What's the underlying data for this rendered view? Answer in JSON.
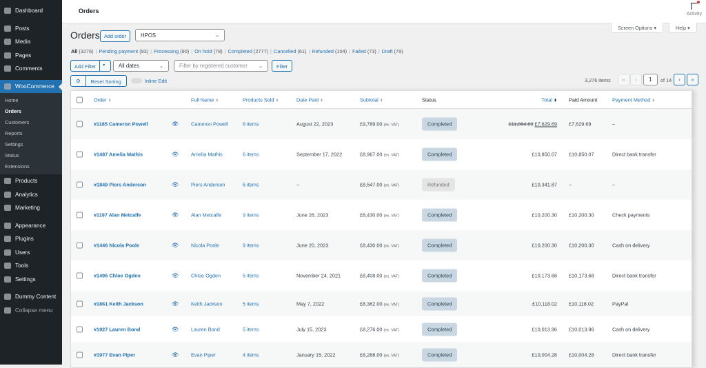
{
  "sidebar": {
    "items_top": [
      {
        "label": "Dashboard",
        "icon": "dashboard-icon"
      }
    ],
    "group1": [
      {
        "label": "Posts",
        "icon": "pin-icon"
      },
      {
        "label": "Media",
        "icon": "media-icon"
      },
      {
        "label": "Pages",
        "icon": "pages-icon"
      },
      {
        "label": "Comments",
        "icon": "comment-icon"
      }
    ],
    "woo": {
      "label": "WooCommerce",
      "icon": "woo-icon",
      "sub": [
        "Home",
        "Orders",
        "Customers",
        "Reports",
        "Settings",
        "Status",
        "Extensions"
      ]
    },
    "group2": [
      {
        "label": "Products",
        "icon": "archive-icon"
      },
      {
        "label": "Analytics",
        "icon": "bar-chart-icon"
      },
      {
        "label": "Marketing",
        "icon": "megaphone-icon"
      }
    ],
    "group3": [
      {
        "label": "Appearance",
        "icon": "brush-icon"
      },
      {
        "label": "Plugins",
        "icon": "plug-icon"
      },
      {
        "label": "Users",
        "icon": "user-icon"
      },
      {
        "label": "Tools",
        "icon": "wrench-icon"
      },
      {
        "label": "Settings",
        "icon": "settings-icon"
      }
    ],
    "group4": [
      {
        "label": "Dummy Content",
        "icon": "database-icon"
      },
      {
        "label": "Collapse menu",
        "icon": "collapse-icon"
      }
    ]
  },
  "header": {
    "title": "Orders",
    "activity": "Activity"
  },
  "screen_options": "Screen Options ▾",
  "help": "Help ▾",
  "page": {
    "title": "Orders",
    "add_order": "Add order",
    "view_select": "HPOS"
  },
  "views": [
    {
      "label": "All",
      "count": "(3276)"
    },
    {
      "label": "Pending payment",
      "count": "(93)"
    },
    {
      "label": "Processing",
      "count": "(90)"
    },
    {
      "label": "On hold",
      "count": "(78)"
    },
    {
      "label": "Completed",
      "count": "(2777)"
    },
    {
      "label": "Cancelled",
      "count": "(61)"
    },
    {
      "label": "Refunded",
      "count": "(104)"
    },
    {
      "label": "Failed",
      "count": "(73)"
    },
    {
      "label": "Draft",
      "count": "(79)"
    }
  ],
  "filters": {
    "add_filter": "Add Filter",
    "dates": "All dates",
    "customer_placeholder": "Filter by registered customer",
    "filter": "Filter",
    "reset_sorting": "Reset Sorting",
    "inline_edit": "Inline Edit"
  },
  "pagination": {
    "items": "3,276 items",
    "first": "«",
    "prev": "‹",
    "current": "1",
    "of": "of 14",
    "next": "›",
    "last": "»"
  },
  "columns": {
    "order": "Order",
    "full_name": "Full Name",
    "products": "Products Sold",
    "date": "Date Paid",
    "subtotal": "Subtotal",
    "status": "Status",
    "total": "Total",
    "paid": "Paid Amount",
    "payment": "Payment Method"
  },
  "vat": "(ex. VAT)",
  "orders": [
    {
      "order": "#1185 Cameron Powell",
      "name": "Cameron Powell",
      "items": "6 items",
      "date": "August 22, 2023",
      "subtotal": "£9,789.00",
      "status": "Completed",
      "total_old": "£11,864.69",
      "total": "£7,629.69",
      "paid": "£7,629.69",
      "method": "–"
    },
    {
      "order": "#1487 Amelia Mathis",
      "name": "Amelia Mathis",
      "items": "6 items",
      "date": "September 17, 2022",
      "subtotal": "£8,967.00",
      "status": "Completed",
      "total": "£10,850.07",
      "paid": "£10,850.07",
      "method": "Direct bank transfer"
    },
    {
      "order": "#1849 Piers Anderson",
      "name": "Piers Anderson",
      "items": "6 items",
      "date": "–",
      "subtotal": "£8,547.00",
      "status": "Refunded",
      "total": "£10,341.87",
      "paid": "–",
      "method": "–"
    },
    {
      "order": "#1197 Alan Metcalfe",
      "name": "Alan Metcalfe",
      "items": "9 items",
      "date": "June 26, 2023",
      "subtotal": "£8,430.00",
      "status": "Completed",
      "total": "£10,200.30",
      "paid": "£10,200.30",
      "method": "Check payments"
    },
    {
      "order": "#1446 Nicola Poole",
      "name": "Nicola Poole",
      "items": "9 items",
      "date": "June 20, 2023",
      "subtotal": "£8,430.00",
      "status": "Completed",
      "total": "£10,200.30",
      "paid": "£10,200.30",
      "method": "Cash on delivery"
    },
    {
      "order": "#1495 Chloe Ogden",
      "name": "Chloe Ogden",
      "items": "5 items",
      "date": "November 24, 2021",
      "subtotal": "£8,408.00",
      "status": "Completed",
      "total": "£10,173.68",
      "paid": "£10,173.68",
      "method": "Direct bank transfer"
    },
    {
      "order": "#1861 Keith Jackson",
      "name": "Keith Jackson",
      "items": "5 items",
      "date": "May 7, 2022",
      "subtotal": "£8,362.00",
      "status": "Completed",
      "total": "£10,118.02",
      "paid": "£10,118.02",
      "method": "PayPal"
    },
    {
      "order": "#1927 Lauren Bond",
      "name": "Lauren Bond",
      "items": "5 items",
      "date": "July 15, 2023",
      "subtotal": "£8,276.00",
      "status": "Completed",
      "total": "£10,013.96",
      "paid": "£10,013.96",
      "method": "Cash on delivery"
    },
    {
      "order": "#1977 Evan Piper",
      "name": "Evan Piper",
      "items": "4 items",
      "date": "January 15, 2022",
      "subtotal": "£8,268.00",
      "status": "Completed",
      "total": "£10,004.28",
      "paid": "£10,004.28",
      "method": "Direct bank transfer"
    }
  ],
  "colors": {
    "accent": "#2271b1",
    "sidebar": "#1d2327",
    "completed_badge": "#c8d7e1",
    "refunded_badge": "#e5e5e5"
  }
}
